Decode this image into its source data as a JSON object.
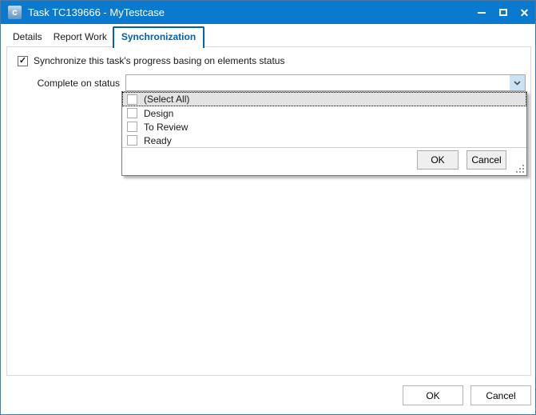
{
  "window": {
    "title": "Task TC139666 - MyTestcase"
  },
  "icons": {
    "app_logo": "c",
    "close": "✕",
    "check": "✓"
  },
  "tabs": [
    {
      "label": "Details",
      "active": false
    },
    {
      "label": "Report Work",
      "active": false
    },
    {
      "label": "Synchronization",
      "active": true
    }
  ],
  "sync": {
    "checkbox_label": "Synchronize this task's progress basing on elements status",
    "checkbox_checked": true,
    "field_label": "Complete on status",
    "combo_value": ""
  },
  "dropdown": {
    "open": true,
    "items": [
      {
        "label": "(Select All)",
        "checked": false,
        "focused": true
      },
      {
        "label": "Design",
        "checked": false,
        "focused": false
      },
      {
        "label": "To Review",
        "checked": false,
        "focused": false
      },
      {
        "label": "Ready",
        "checked": false,
        "focused": false
      }
    ],
    "ok": "OK",
    "cancel": "Cancel"
  },
  "footer": {
    "ok": "OK",
    "cancel": "Cancel"
  },
  "colors": {
    "titlebar": "#0a79d0",
    "window_border": "#4b7aa5",
    "active_tab": "#0062b1",
    "combo_button_bg": "#cbe2f5",
    "row_highlight": "#e3e3e3"
  }
}
